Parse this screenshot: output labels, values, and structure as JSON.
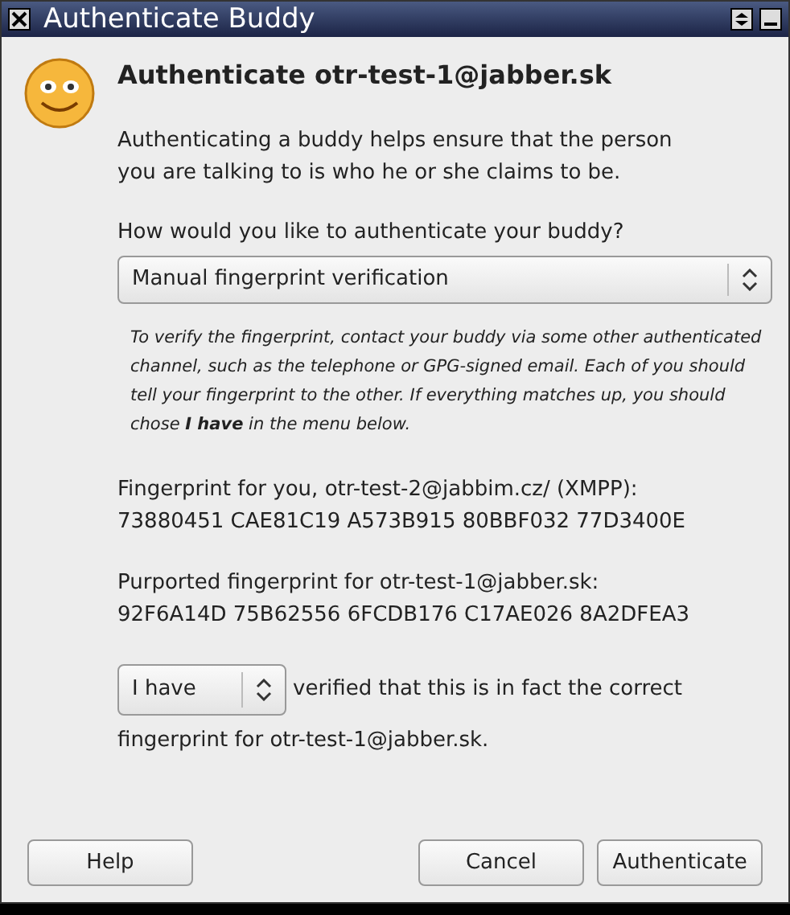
{
  "window": {
    "title": "Authenticate Buddy"
  },
  "heading": "Authenticate otr-test-1@jabber.sk",
  "intro": "Authenticating a buddy helps ensure that the person you are talking to is who he or she claims to be.",
  "method": {
    "label": "How would you like to authenticate your buddy?",
    "value": "Manual fingerprint verification"
  },
  "instructions": "To verify the fingerprint, contact your buddy via some other authenticated channel, such as the telephone or GPG-signed email.  Each of you should tell your fingerprint to the other. If everything matches up, you should chose **I have** in the menu below.",
  "fingerprints": [
    {
      "label": "Fingerprint for you, otr-test-2@jabbim.cz/ (XMPP):",
      "value": "73880451 CAE81C19 A573B915 80BBF032 77D3400E"
    },
    {
      "label": "Purported fingerprint for otr-test-1@jabber.sk:",
      "value": "92F6A14D 75B62556 6FCDB176 C17AE026 8A2DFEA3"
    }
  ],
  "verify": {
    "value": "I have",
    "sentence_lines": [
      "verified that this is in fact the correct",
      "fingerprint for otr-test-1@jabber.sk."
    ]
  },
  "buttons": {
    "help": "Help",
    "cancel": "Cancel",
    "ok": "Authenticate"
  }
}
